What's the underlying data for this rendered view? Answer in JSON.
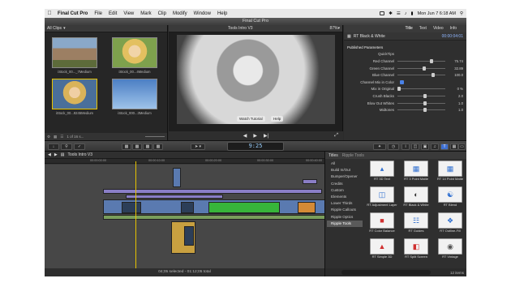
{
  "menubar": {
    "apple": "",
    "app": "Final Cut Pro",
    "items": [
      "File",
      "Edit",
      "View",
      "Mark",
      "Clip",
      "Modify",
      "Window",
      "Help"
    ],
    "clock": "Mon Jun 7  6:18 AM"
  },
  "window_title": "Final Cut Pro",
  "browser": {
    "filter": "All Clips",
    "clips": [
      {
        "name": "iStock_00..._7Medium",
        "image": "building"
      },
      {
        "name": "iStock_00...4Medium",
        "image": "woman-smiling"
      },
      {
        "name": "iStock_00...9245Medium",
        "image": "woman-portrait",
        "selected": true
      },
      {
        "name": "iStock_000...3Medium",
        "image": "sky"
      }
    ],
    "footer": "1 of 16 s..."
  },
  "viewer": {
    "title": "Tools Intro V3",
    "zoom": "87%",
    "buttons": {
      "tutorial": "Watch Tutorial",
      "help": "Help"
    }
  },
  "inspector": {
    "tabs": [
      "Title",
      "Text",
      "Video",
      "Info"
    ],
    "effect": "RT Black & White",
    "timecode": "00:00:04:01",
    "section": "Published Parameters",
    "quicktips": "QuickTips",
    "params": [
      {
        "label": "Red Channel",
        "value": "75.74",
        "level": 0.68
      },
      {
        "label": "Green Channel",
        "value": "32.89",
        "level": 0.52
      },
      {
        "label": "Blue Channel",
        "value": "100.0",
        "level": 0.72
      },
      {
        "label": "Channel Mix in Color",
        "value": "",
        "level": null
      },
      {
        "label": "Mix in Original",
        "value": "0  %",
        "level": 0.0
      },
      {
        "label": "Crush Blacks",
        "value": "2.0",
        "level": 0.55
      },
      {
        "label": "Blow Out Whites",
        "value": "1.0",
        "level": 0.55
      },
      {
        "label": "Midtones",
        "value": "1.0",
        "level": 0.55
      }
    ]
  },
  "toolbar": {
    "timecode": "9:25"
  },
  "timeline": {
    "project": "Tools Intro V3",
    "ruler_ticks": [
      "00:00:00:00",
      "00:00:10:00",
      "00:00:20:00",
      "00:00:30:00",
      "00:00:40:00"
    ],
    "status": "04;05 selected - 01:12;05 total"
  },
  "titles": {
    "tabs": [
      "Titles",
      "Ripple Tools"
    ],
    "categories": [
      "All",
      "Build In/Out",
      "Bumper/Opener",
      "Credits",
      "Custom",
      "Elements",
      "Lower Thirds",
      "Ripple Callouts",
      "Ripple Optics",
      "Ripple Tools"
    ],
    "selected_category": "Ripple Tools",
    "items": [
      {
        "label": "RT 3D Text",
        "icon": "3d-text-icon"
      },
      {
        "label": "RT 3 Point Matte",
        "icon": "matte-icon"
      },
      {
        "label": "RT 14 Point Matte",
        "icon": "matte-icon"
      },
      {
        "label": "RT Adjustment Layer",
        "icon": "layers-icon"
      },
      {
        "label": "RT Black & White",
        "icon": "bw-icon"
      },
      {
        "label": "RT Blend",
        "icon": "blend-icon"
      },
      {
        "label": "RT Color Balance",
        "icon": "color-balance-icon"
      },
      {
        "label": "RT Guides",
        "icon": "guides-icon"
      },
      {
        "label": "RT Outline-Fill",
        "icon": "outline-icon"
      },
      {
        "label": "RT Simple 3D",
        "icon": "cube-icon"
      },
      {
        "label": "RT Split Screen",
        "icon": "split-icon"
      },
      {
        "label": "RT Vintage",
        "icon": "film-icon"
      }
    ],
    "count": "12 items"
  }
}
